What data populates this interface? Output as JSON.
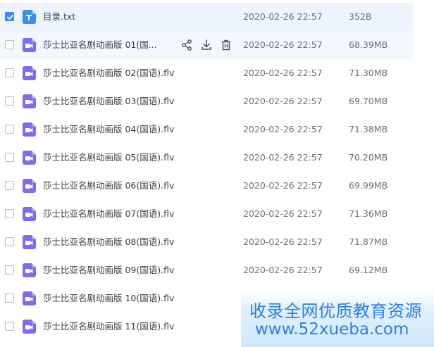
{
  "files": [
    {
      "name": "目录.txt",
      "date": "2020-02-26 22:57",
      "size": "352B",
      "type": "text",
      "selected": true
    },
    {
      "name": "莎士比亚名剧动画版 01(国...",
      "date": "2020-02-26 22:57",
      "size": "68.39MB",
      "type": "video",
      "hovered": true
    },
    {
      "name": "莎士比亚名剧动画版 02(国语).flv",
      "date": "2020-02-26 22:57",
      "size": "71.30MB",
      "type": "video"
    },
    {
      "name": "莎士比亚名剧动画版 03(国语).flv",
      "date": "2020-02-26 22:57",
      "size": "69.70MB",
      "type": "video"
    },
    {
      "name": "莎士比亚名剧动画版 04(国语).flv",
      "date": "2020-02-26 22:57",
      "size": "71.38MB",
      "type": "video"
    },
    {
      "name": "莎士比亚名剧动画版 05(国语).flv",
      "date": "2020-02-26 22:57",
      "size": "70.20MB",
      "type": "video"
    },
    {
      "name": "莎士比亚名剧动画版 06(国语).flv",
      "date": "2020-02-26 22:57",
      "size": "69.99MB",
      "type": "video"
    },
    {
      "name": "莎士比亚名剧动画版 07(国语).flv",
      "date": "2020-02-26 22:57",
      "size": "71.36MB",
      "type": "video"
    },
    {
      "name": "莎士比亚名剧动画版 08(国语).flv",
      "date": "2020-02-26 22:57",
      "size": "71.87MB",
      "type": "video"
    },
    {
      "name": "莎士比亚名剧动画版 09(国语).flv",
      "date": "2020-02-26 22:57",
      "size": "69.12MB",
      "type": "video"
    },
    {
      "name": "莎士比亚名剧动画版 10(国语).flv",
      "date": "",
      "size": "",
      "type": "video"
    },
    {
      "name": "莎士比亚名剧动画版 11(国语).flv",
      "date": "",
      "size": "",
      "type": "video"
    }
  ],
  "row_actions": {
    "icons": [
      "share-icon",
      "download-icon",
      "delete-icon"
    ]
  },
  "watermark": {
    "line1": "收录全网优质教育资源",
    "line2": "www.52xueba.com"
  },
  "colors": {
    "accent": "#3b8cf5",
    "selected_row": "#edf4fe",
    "hovered_row": "#f3f8ff",
    "text_file_icon": "#3b8cf5",
    "video_file_icon": "#7b6cf0",
    "watermark_text": "#2c7fe5"
  }
}
